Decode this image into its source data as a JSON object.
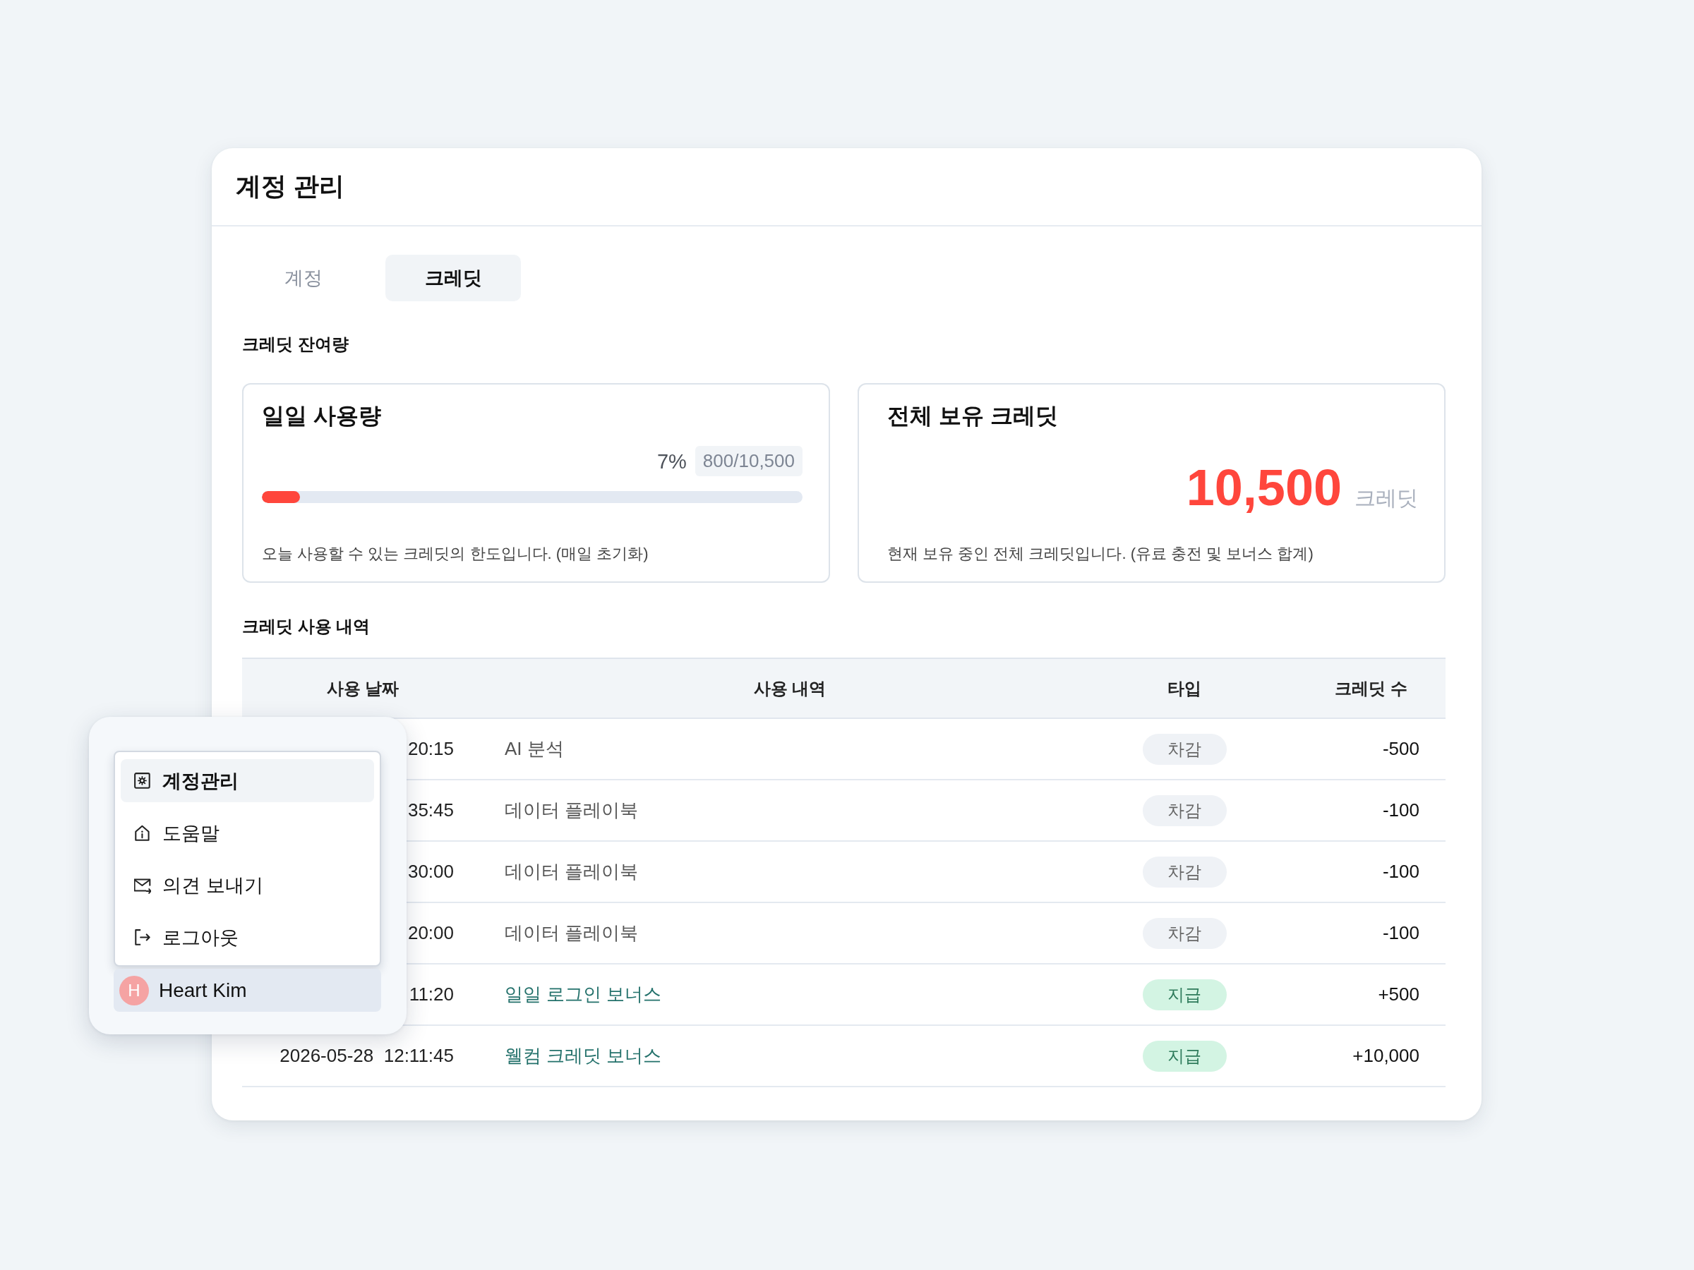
{
  "panel": {
    "title": "계정 관리"
  },
  "tabs": [
    {
      "label": "계정",
      "selected": false
    },
    {
      "label": "크레딧",
      "selected": true
    }
  ],
  "balance": {
    "heading": "크레딧 잔여량",
    "daily": {
      "title": "일일 사용량",
      "percent": "7%",
      "usage": "800/10,500",
      "level": 0.07,
      "note": "오늘 사용할 수 있는 크레딧의 한도입니다. (매일 초기화)"
    },
    "total": {
      "title": "전체 보유 크레딧",
      "amount": "10,500",
      "unit": "크레딧",
      "note": "현재 보유 중인 전체 크레딧입니다. (유료 충전 및 보너스 합계)"
    }
  },
  "history": {
    "heading": "크레딧 사용 내역",
    "columns": [
      "사용 날짜",
      "사용 내역",
      "타입",
      "크레딧 수"
    ],
    "rows": [
      {
        "kind": "debit",
        "date": "20:15",
        "description": "AI 분석",
        "type": "차감",
        "amount": "-500"
      },
      {
        "kind": "debit",
        "date": "35:45",
        "description": "데이터 플레이북",
        "type": "차감",
        "amount": "-100"
      },
      {
        "kind": "debit",
        "date": "30:00",
        "description": "데이터 플레이북",
        "type": "차감",
        "amount": "-100"
      },
      {
        "kind": "debit",
        "date": "20:00",
        "description": "데이터 플레이북",
        "type": "차감",
        "amount": "-100"
      },
      {
        "kind": "credit",
        "date": "11:20",
        "description": "일일 로그인 보너스",
        "type": "지급",
        "amount": "+500"
      },
      {
        "kind": "credit",
        "date": "2026-05-28  12:11:45",
        "description": "웰컴 크레딧 보너스",
        "type": "지급",
        "amount": "+10,000"
      }
    ]
  },
  "account_menu": {
    "items": [
      {
        "label": "계정관리",
        "selected": true
      },
      {
        "label": "도움말",
        "selected": false
      },
      {
        "label": "의견 보내기",
        "selected": false
      },
      {
        "label": "로그아웃",
        "selected": false
      }
    ],
    "user": {
      "initial": "H",
      "name": "Heart Kim"
    }
  }
}
